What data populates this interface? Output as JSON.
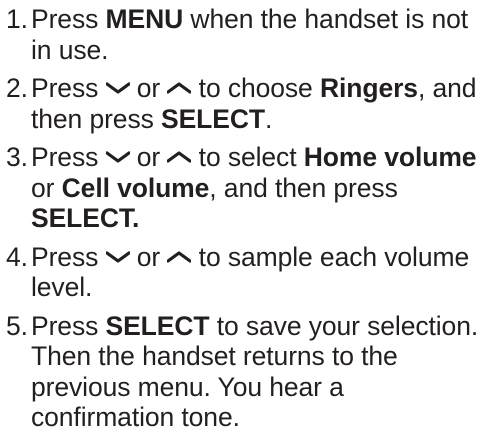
{
  "steps": [
    {
      "number": "1.",
      "parts": [
        "Press ",
        "MENU",
        " when the handset is not in use."
      ]
    },
    {
      "number": "2.",
      "parts": [
        "Press ",
        "or",
        " to choose ",
        "Ringers",
        ", and then press ",
        "SELECT",
        "."
      ]
    },
    {
      "number": "3.",
      "parts": [
        "Press ",
        "or",
        " to select ",
        "Home volume",
        " or ",
        "Cell volume",
        ", and then press ",
        "SELECT."
      ]
    },
    {
      "number": "4.",
      "parts": [
        "Press ",
        "or",
        " to sample each volume level."
      ]
    },
    {
      "number": "5.",
      "parts": [
        "Press ",
        "SELECT",
        " to save your selection. Then the handset returns to the previous menu. You hear a confirmation tone."
      ]
    }
  ],
  "icons": {
    "down": "chevron-down-icon",
    "up": "chevron-up-icon"
  },
  "colors": {
    "text": "#231f20"
  }
}
